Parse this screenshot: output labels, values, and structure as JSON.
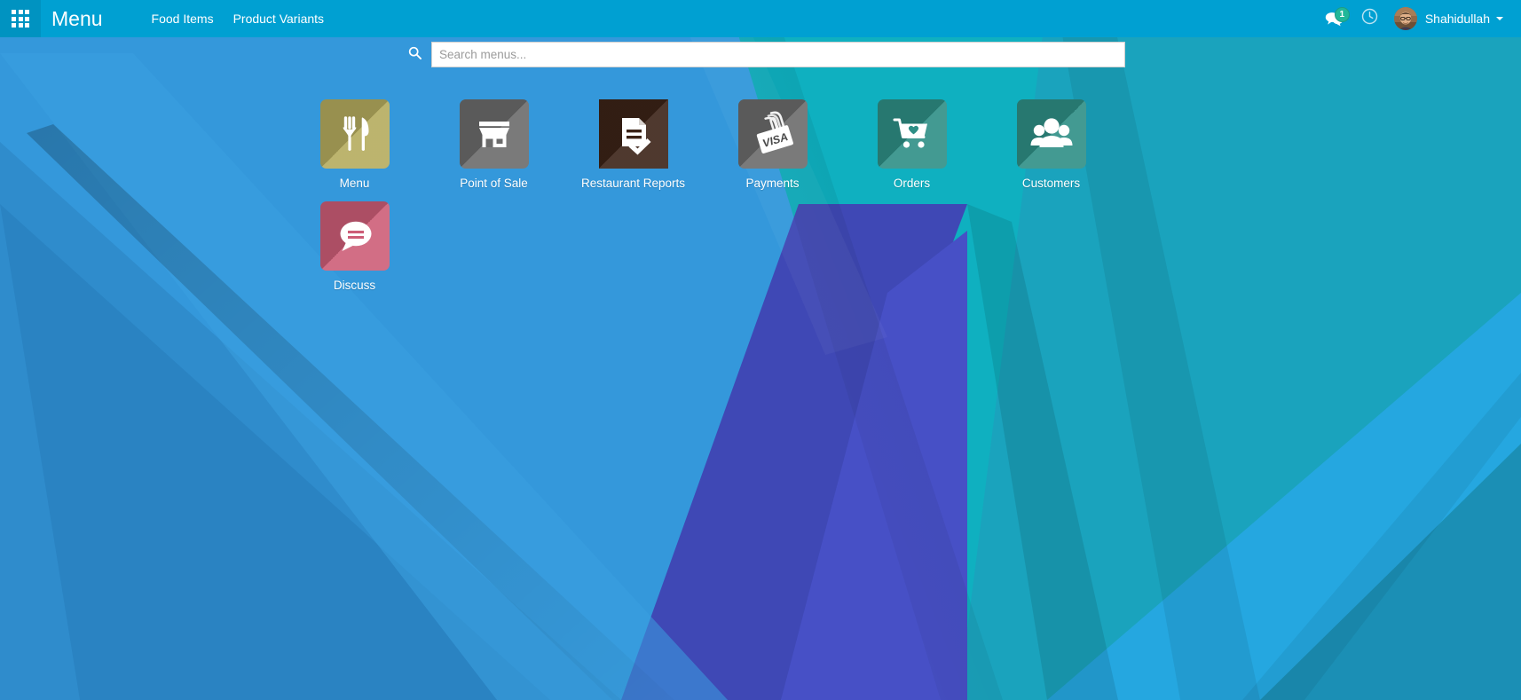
{
  "navbar": {
    "apps_grid_icon": "apps-grid-icon",
    "title": "Menu",
    "menu_items": [
      {
        "label": "Food Items"
      },
      {
        "label": "Product Variants"
      }
    ],
    "messages": {
      "icon": "chat-bubbles-icon",
      "badge_count": "1",
      "badge_color": "#21b799"
    },
    "activity": {
      "icon": "clock-icon"
    },
    "user": {
      "name": "Shahidullah",
      "avatar": "user-avatar-photo",
      "caret": "chevron-down-icon"
    },
    "background_color": "#00a0d2"
  },
  "search": {
    "icon": "search-icon",
    "placeholder": "Search menus...",
    "value": ""
  },
  "apps": [
    {
      "label": "Menu",
      "icon": "fork-knife-icon",
      "tile_color": "#b5ab5e",
      "tile_color_dark": "#9c9350",
      "rounded": true
    },
    {
      "label": "Point of Sale",
      "icon": "storefront-icon",
      "tile_color": "#6b6b6b",
      "tile_color_dark": "#545454",
      "rounded": true
    },
    {
      "label": "Restaurant Reports",
      "icon": "document-check-icon",
      "tile_color": "#3b2317",
      "tile_color_dark": "#24130b",
      "rounded": false
    },
    {
      "label": "Payments",
      "icon": "visa-card-icon",
      "tile_color": "#6b6b6b",
      "tile_color_dark": "#545454",
      "rounded": true
    },
    {
      "label": "Orders",
      "icon": "shopping-cart-heart-icon",
      "tile_color": "#2e8f86",
      "tile_color_dark": "#247a72",
      "rounded": true
    },
    {
      "label": "Customers",
      "icon": "people-group-icon",
      "tile_color": "#2e8f86",
      "tile_color_dark": "#247a72",
      "rounded": true
    },
    {
      "label": "Discuss",
      "icon": "speech-bubble-icon",
      "tile_color": "#cd5d77",
      "tile_color_dark": "#b44e66",
      "rounded": true
    }
  ],
  "wallpaper": {
    "base_color": "#3498db",
    "palette": [
      "#3498db",
      "#2f8ccc",
      "#2d88c4",
      "#00a6b8",
      "#0fb5c4",
      "#29a8d8",
      "#3f48b5",
      "#4a52c4",
      "#1a7ab0"
    ]
  }
}
